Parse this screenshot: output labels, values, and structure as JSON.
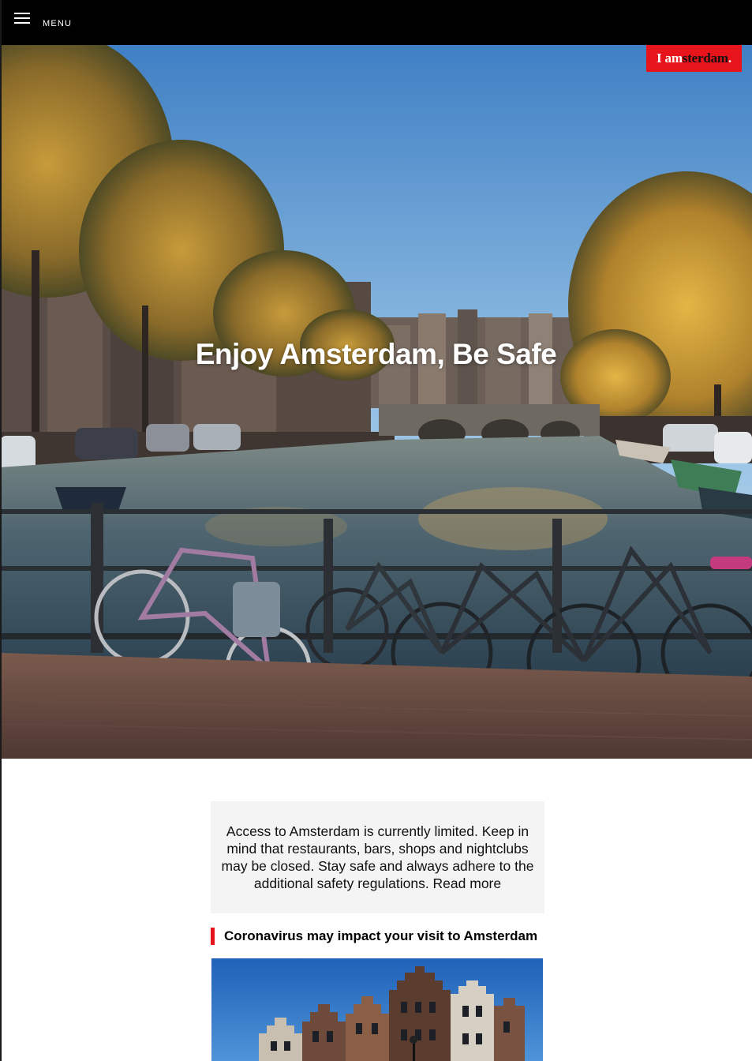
{
  "topbar": {
    "menu_label": "MENU",
    "menu_icon": "hamburger-icon"
  },
  "hero": {
    "title": "Enjoy Amsterdam, Be Safe",
    "logo": {
      "prefix": "I ",
      "am": "am",
      "sterdam": "sterdam",
      "dot": ".",
      "color": "#e8141c"
    }
  },
  "notice": {
    "text": "Access to Amsterdam is currently limited. Keep in mind that restaurants, bars, shops and nightclubs may be closed. Stay safe and always adhere to the additional safety regulations.",
    "link_text": "Read more"
  },
  "section": {
    "title": "Coronavirus may impact your visit to Amsterdam",
    "accent_color": "#e8141c"
  }
}
